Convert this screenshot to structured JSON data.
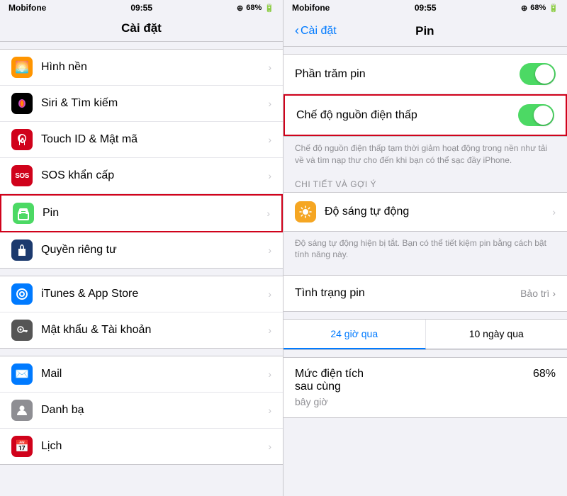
{
  "left": {
    "status": {
      "carrier": "Mobifone",
      "time": "09:55",
      "battery": "68%"
    },
    "title": "Cài đặt",
    "items": [
      {
        "id": "hinh-nen",
        "label": "Hình nền",
        "iconBg": "#ff9500",
        "iconText": "🌅"
      },
      {
        "id": "siri",
        "label": "Siri & Tìm kiếm",
        "iconBg": "#000",
        "iconText": "🔮"
      },
      {
        "id": "touch-id",
        "label": "Touch ID & Mật mã",
        "iconBg": "#d0021b",
        "iconText": "👆"
      },
      {
        "id": "sos",
        "label": "SOS khẩn cấp",
        "iconBg": "#d0021b",
        "iconText": "SOS"
      },
      {
        "id": "pin",
        "label": "Pin",
        "iconBg": "#4cd964",
        "iconText": "🔋",
        "highlighted": true
      },
      {
        "id": "quyen-rieng-tu",
        "label": "Quyền riêng tư",
        "iconBg": "#1c3a6e",
        "iconText": "✋"
      },
      {
        "id": "itunes",
        "label": "iTunes & App Store",
        "iconBg": "#007aff",
        "iconText": "🅐"
      },
      {
        "id": "mat-khau",
        "label": "Mật khẩu & Tài khoản",
        "iconBg": "#555",
        "iconText": "🔑"
      },
      {
        "id": "mail",
        "label": "Mail",
        "iconBg": "#007aff",
        "iconText": "✉️"
      },
      {
        "id": "danh-ba",
        "label": "Danh bạ",
        "iconBg": "#8e8e93",
        "iconText": "👤"
      },
      {
        "id": "lich",
        "label": "Lịch",
        "iconBg": "#d0021b",
        "iconText": "📅"
      }
    ]
  },
  "right": {
    "status": {
      "carrier": "Mobifone",
      "time": "09:55",
      "battery": "68%"
    },
    "back_label": "Cài đặt",
    "title": "Pin",
    "phan_tram_pin_label": "Phần trăm pin",
    "che_do_label": "Chế độ nguồn điện thấp",
    "che_do_desc": "Chế độ nguồn điện thấp tạm thời giảm hoạt động trong nền như tải về và tìm nạp thư cho đến khi bạn có thể sạc đầy iPhone.",
    "section_chi_tiet": "CHI TIẾT VÀ GỢI Ý",
    "do_sang_label": "Độ sáng tự động",
    "do_sang_desc": "Độ sáng tự động hiện bị tắt. Bạn có thể tiết kiệm pin bằng cách bật tính năng này.",
    "tinh_trang_label": "Tình trạng pin",
    "tinh_trang_value": "Bảo trì",
    "tab_24h": "24 giờ qua",
    "tab_10d": "10 ngày qua",
    "muc_dien_label": "Mức điện tích\nsau cùng",
    "muc_dien_sub": "bây giờ",
    "muc_dien_value": "68%"
  }
}
